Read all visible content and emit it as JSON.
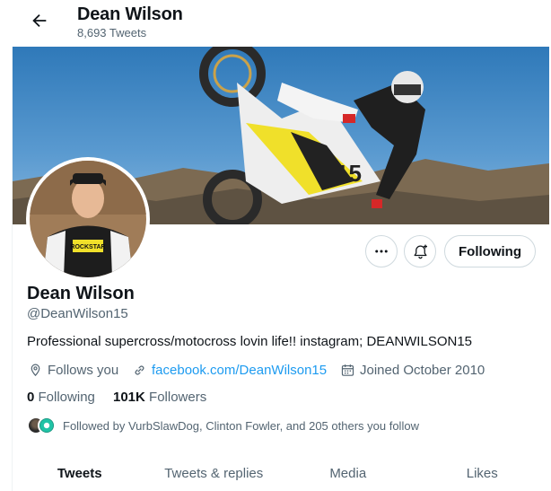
{
  "header": {
    "name": "Dean Wilson",
    "tweet_count": "8,693 Tweets"
  },
  "profile": {
    "name": "Dean Wilson",
    "handle": "@DeanWilson15",
    "bio": "Professional supercross/motocross lovin life!! instagram; DEANWILSON15",
    "follows_you": "Follows you",
    "link": "facebook.com/DeanWilson15",
    "joined": "Joined October 2010",
    "following_count": "0",
    "following_label": "Following",
    "followers_count": "101K",
    "followers_label": "Followers",
    "followed_by": "Followed by VurbSlawDog, Clinton Fowler, and 205 others you follow"
  },
  "actions": {
    "following_button": "Following"
  },
  "tabs": [
    {
      "label": "Tweets",
      "active": true
    },
    {
      "label": "Tweets & replies",
      "active": false
    },
    {
      "label": "Media",
      "active": false
    },
    {
      "label": "Likes",
      "active": false
    }
  ],
  "icons": {
    "back": "arrow-left-icon",
    "more": "more-horizontal-icon",
    "bell": "bell-plus-icon",
    "location": "location-pin-icon",
    "link": "link-icon",
    "calendar": "calendar-icon"
  },
  "colors": {
    "accent": "#1d9bf0",
    "text": "#0f1419",
    "secondary": "#536471",
    "border": "#cfd9de"
  }
}
